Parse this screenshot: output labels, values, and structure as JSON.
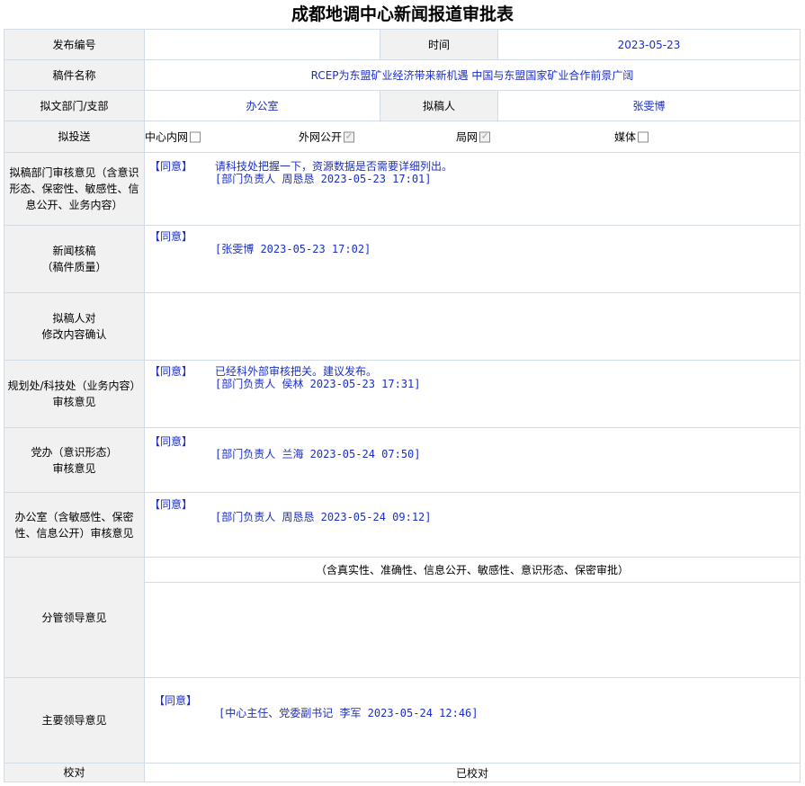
{
  "page_title": "成都地调中心新闻报道审批表",
  "fields": {
    "number_label": "发布编号",
    "number_value": "",
    "time_label": "时间",
    "time_value": "2023-05-23",
    "manuscript_label": "稿件名称",
    "manuscript_value": "RCEP为东盟矿业经济带来新机遇 中国与东盟国家矿业合作前景广阔",
    "dept_label": "拟文部门/支部",
    "dept_value": "办公室",
    "drafter_label": "拟稿人",
    "drafter_value": "张雯博",
    "send_label": "拟投送"
  },
  "send_options": [
    {
      "label": "中心内网",
      "checked": false
    },
    {
      "label": "外网公开",
      "checked": true
    },
    {
      "label": "局网",
      "checked": true
    },
    {
      "label": "媒体",
      "checked": false
    }
  ],
  "opinions": {
    "dept_review": {
      "label": "拟稿部门审核意见（含意识形态、保密性、敏感性、信息公开、业务内容）",
      "tag": "【同意】",
      "text": "请科技处把握一下，资源数据是否需要详细列出。",
      "sign": "[部门负责人 周恳恳 2023-05-23 17:01]"
    },
    "news_check": {
      "label1": "新闻核稿",
      "label2": "（稿件质量）",
      "tag": "【同意】",
      "sign": "[张雯博 2023-05-23 17:02]"
    },
    "drafter_confirm": {
      "label1": "拟稿人对",
      "label2": "修改内容确认"
    },
    "planning_review": {
      "label1": "规划处/科技处（业务内容）",
      "label2": "审核意见",
      "tag": "【同意】",
      "text": "已经科外部审核把关。建议发布。",
      "sign": "[部门负责人 侯林 2023-05-23 17:31]"
    },
    "party_review": {
      "label1": "党办（意识形态）",
      "label2": "审核意见",
      "tag": "【同意】",
      "sign": "[部门负责人 兰海 2023-05-24 07:50]"
    },
    "office_review": {
      "label": "办公室（含敏感性、保密性、信息公开）审核意见",
      "tag": "【同意】",
      "sign": "[部门负责人 周恳恳 2023-05-24 09:12]"
    },
    "leader_review": {
      "label": "分管领导意见",
      "note": "（含真实性、准确性、信息公开、敏感性、意识形态、保密审批）"
    },
    "main_leader": {
      "label": "主要领导意见",
      "tag": "【同意】",
      "sign": "[中心主任、党委副书记 李军 2023-05-24 12:46]"
    },
    "proofread": {
      "label": "校对",
      "value": "已校对"
    }
  }
}
